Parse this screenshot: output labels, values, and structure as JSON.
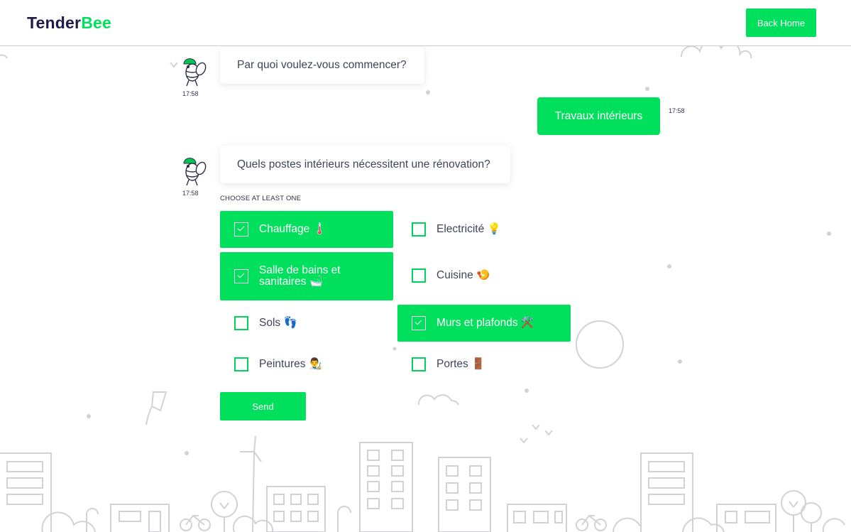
{
  "header": {
    "logo_part1": "Tender",
    "logo_part2": "Bee",
    "back_home_label": "Back Home"
  },
  "chat": {
    "messages": [
      {
        "from": "bot",
        "text": "Par quoi voulez-vous commencer?",
        "time": "17:58"
      },
      {
        "from": "user",
        "text": "Travaux intérieurs",
        "time": "17:58"
      },
      {
        "from": "bot",
        "text": "Quels postes intérieurs nécessitent une rénovation?",
        "time": "17:58"
      }
    ]
  },
  "choices": {
    "hint": "CHOOSE AT LEAST ONE",
    "options": [
      {
        "label": "Chauffage",
        "icon": "thermometer-icon",
        "emoji": "🌡️",
        "checked": true
      },
      {
        "label": "Electricité",
        "icon": "light-bulb-icon",
        "emoji": "💡",
        "checked": false
      },
      {
        "label": "Salle de bains et sanitaires",
        "icon": "bathtub-icon",
        "emoji": "🛁",
        "checked": true
      },
      {
        "label": "Cuisine",
        "icon": "shrimp-icon",
        "emoji": "🍤",
        "checked": false
      },
      {
        "label": "Sols",
        "icon": "footprints-icon",
        "emoji": "👣",
        "checked": false
      },
      {
        "label": "Murs et plafonds",
        "icon": "hammer-and-pick-icon",
        "emoji": "⚒️",
        "checked": true
      },
      {
        "label": "Peintures",
        "icon": "artist-icon",
        "emoji": "👨‍🎨",
        "checked": false
      },
      {
        "label": "Portes",
        "icon": "door-icon",
        "emoji": "🚪",
        "checked": false
      }
    ],
    "send_label": "Send"
  },
  "colors": {
    "accent": "#00e05c",
    "logo_dark": "#1f1b4d",
    "text": "#3f4459",
    "decoration": "#cfcfd3"
  }
}
